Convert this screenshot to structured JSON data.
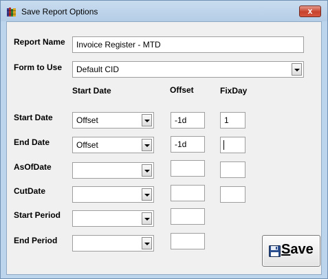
{
  "window": {
    "title": "Save Report Options",
    "close_label": "x"
  },
  "form": {
    "report_name_label": "Report Name",
    "report_name_value": "Invoice Register - MTD",
    "form_to_use_label": "Form to Use",
    "form_to_use_value": "Default CID"
  },
  "columns": {
    "start_date": "Start Date",
    "offset": "Offset",
    "fixday": "FixDay"
  },
  "rows": [
    {
      "label": "Start Date",
      "type": "Offset",
      "offset": "-1d",
      "fixday": "1"
    },
    {
      "label": "End Date",
      "type": "Offset",
      "offset": "-1d",
      "fixday": ""
    },
    {
      "label": "AsOfDate",
      "type": "",
      "offset": "",
      "fixday": ""
    },
    {
      "label": "CutDate",
      "type": "",
      "offset": "",
      "fixday": ""
    },
    {
      "label": "Start Period",
      "type": "",
      "offset": ""
    },
    {
      "label": "End Period",
      "type": "",
      "offset": ""
    }
  ],
  "save_button": {
    "first_letter": "S",
    "rest": "ave"
  },
  "colors": {
    "frame": "#bcd4ec",
    "client": "#f0f0f0",
    "close": "#c7422c",
    "disk": "#2b4f8f"
  },
  "icons": {
    "app": "books-icon",
    "save": "floppy-disk-icon",
    "close": "close-icon",
    "dropdown": "chevron-down-icon"
  }
}
